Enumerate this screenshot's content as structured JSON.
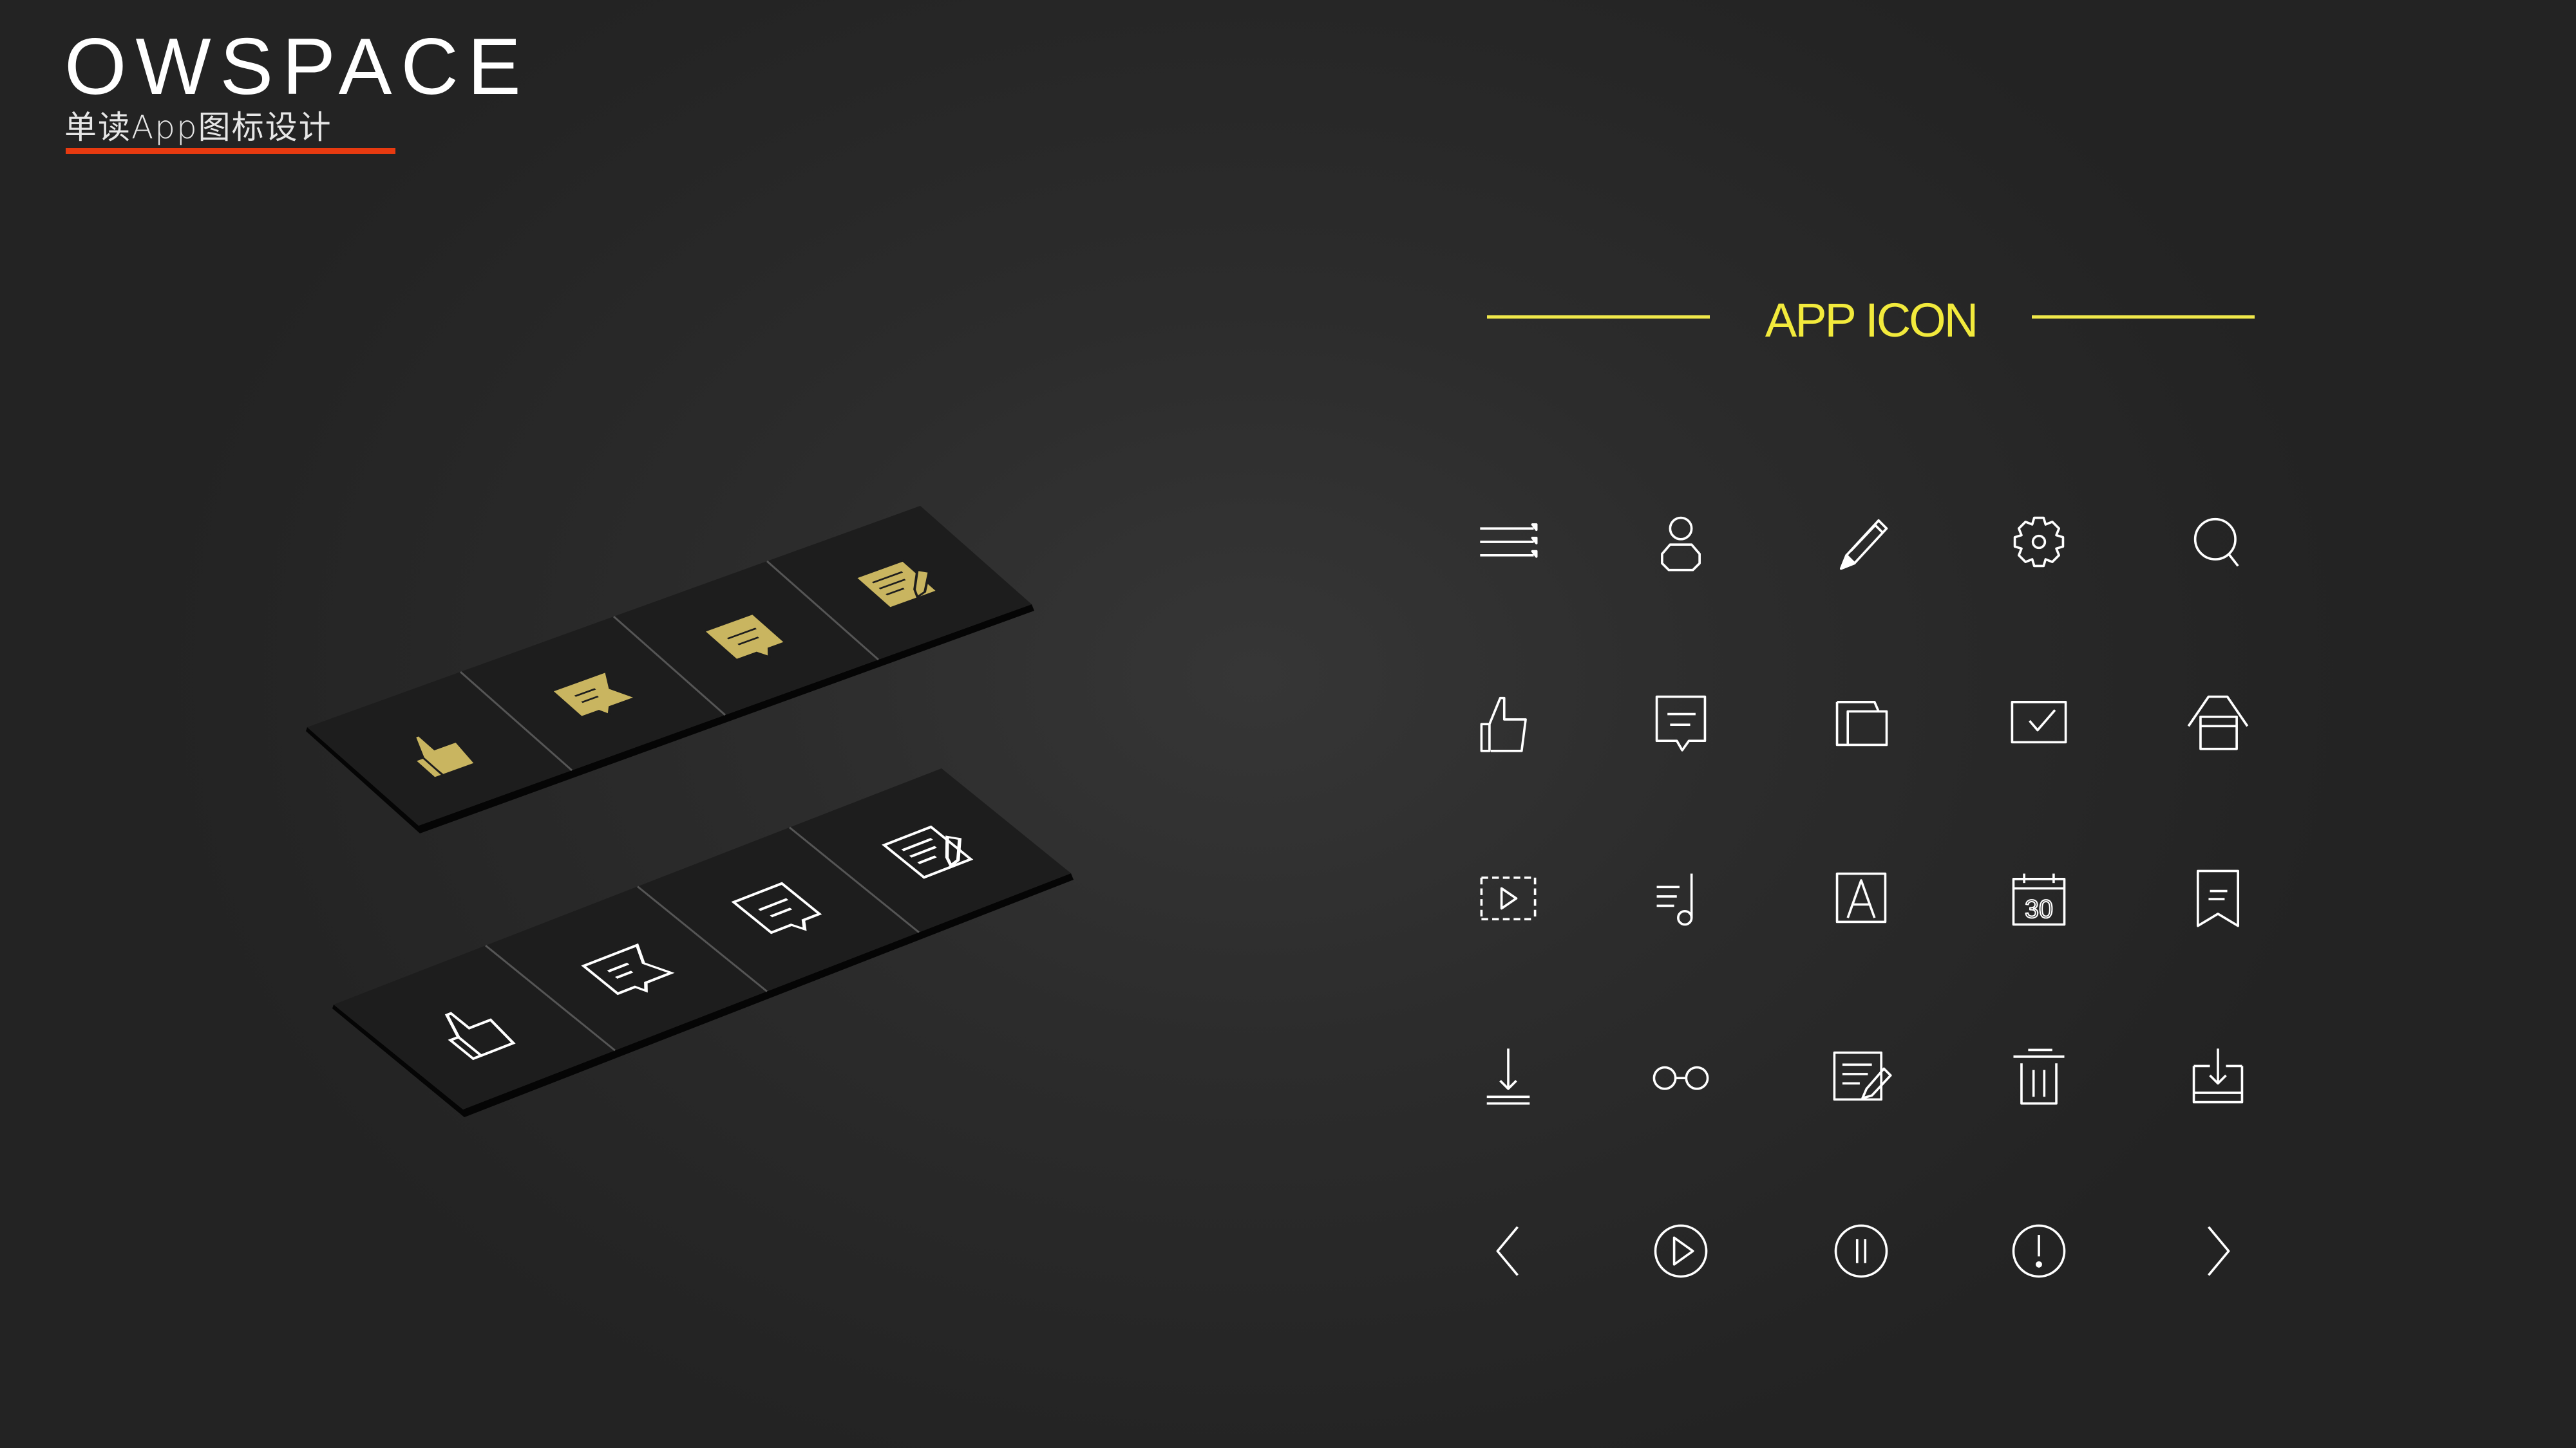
{
  "header": {
    "brand": "OWSPACE",
    "subtitle": "单读App图标设计",
    "accent_color": "#e83a10"
  },
  "section": {
    "title": "APP ICON",
    "accent_color": "#f0e84a"
  },
  "icon_grid": [
    [
      "menu-icon",
      "user-icon",
      "pencil-icon",
      "gear-icon",
      "search-icon"
    ],
    [
      "thumbs-up-icon",
      "comment-icon",
      "share-icon",
      "checkbox-icon",
      "home-icon"
    ],
    [
      "video-icon",
      "music-icon",
      "font-icon",
      "calendar-icon",
      "bookmark-icon"
    ],
    [
      "download-icon",
      "glasses-icon",
      "edit-list-icon",
      "trash-icon",
      "inbox-download-icon"
    ],
    [
      "chevron-left-icon",
      "play-circle-icon",
      "pause-circle-icon",
      "alert-circle-icon",
      "chevron-right-icon"
    ]
  ],
  "calendar_day": "30",
  "isometric_strips": [
    {
      "style": "filled",
      "color": "#c9b560",
      "icons": [
        "thumbs-up-icon",
        "flag-comment-icon",
        "comment-icon",
        "edit-list-icon"
      ]
    },
    {
      "style": "outline",
      "color": "#ffffff",
      "icons": [
        "thumbs-up-icon",
        "flag-comment-icon",
        "comment-icon",
        "edit-list-icon"
      ]
    }
  ]
}
